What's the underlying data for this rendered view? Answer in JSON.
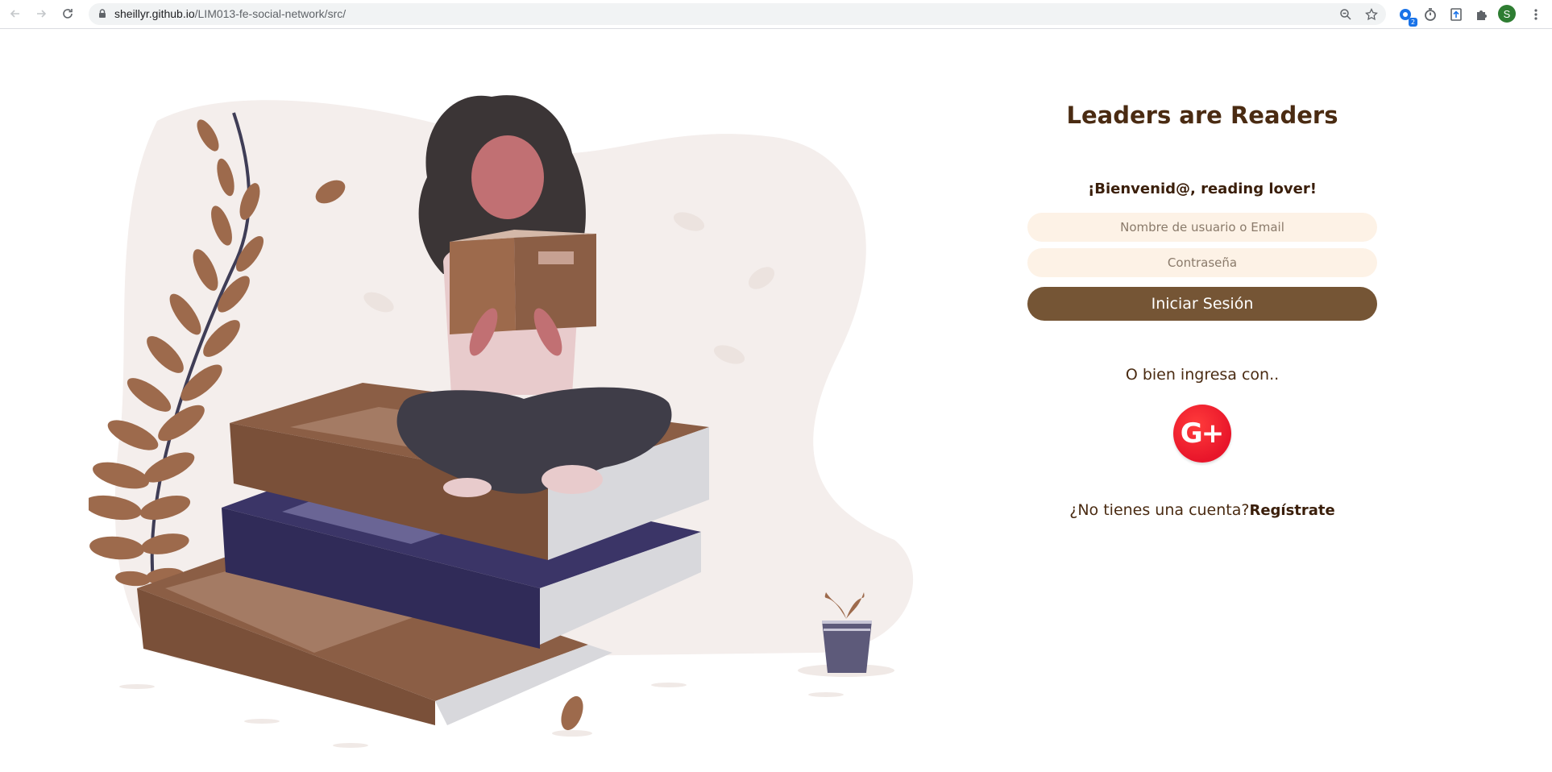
{
  "browser": {
    "url_host": "sheillyr.github.io",
    "url_path": "/LIM013-fe-social-network/src/",
    "extension_badge": "2",
    "profile_initial": "S"
  },
  "login": {
    "title": "Leaders are Readers",
    "welcome": "¡Bienvenid@, reading lover!",
    "username_placeholder": "Nombre de usuario o Email",
    "password_placeholder": "Contraseña",
    "login_button": "Iniciar Sesión",
    "alt_login_text": "O bien ingresa con..",
    "google_label": "G+",
    "signup_prompt": "¿No tienes una cuenta?",
    "signup_link": "Regístrate"
  },
  "colors": {
    "title": "#4a2b12",
    "input_bg": "#fdf2e6",
    "button_bg": "#755535",
    "google": "#e8152a"
  }
}
